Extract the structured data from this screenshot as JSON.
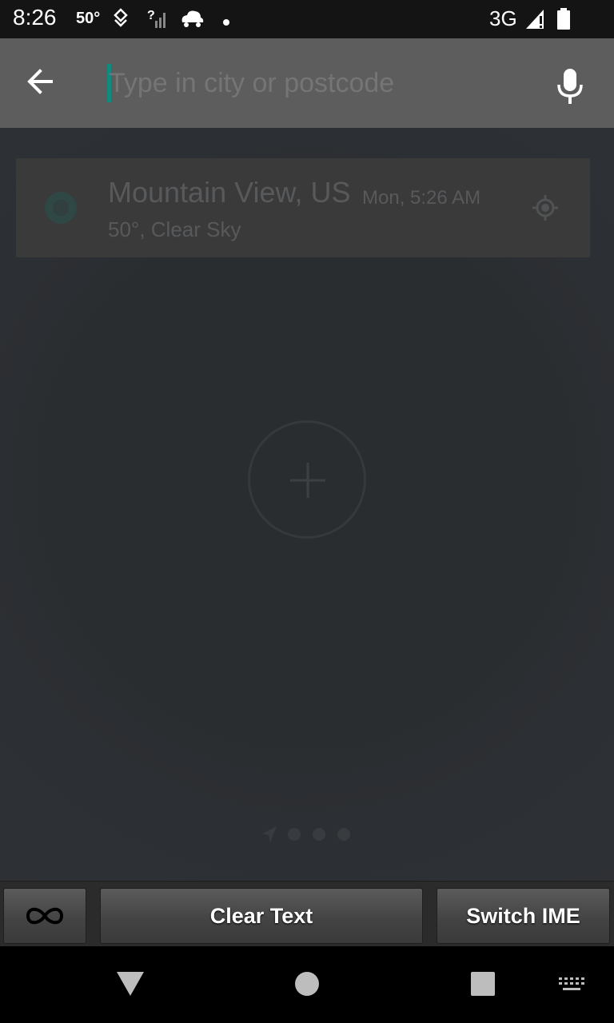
{
  "status_bar": {
    "time": "8:26",
    "temperature": "50°",
    "network": "3G",
    "icons": [
      "location-icon",
      "signal-unknown-icon",
      "cloud-car-icon",
      "notification-dot-icon",
      "cell-signal-icon",
      "battery-icon"
    ]
  },
  "app_bar": {
    "back_icon": "arrow-back-icon",
    "search": {
      "value": "",
      "placeholder": "Type in city or postcode"
    },
    "mic_icon": "microphone-icon",
    "accent_color": "#0f8a7c"
  },
  "city_card": {
    "name": "Mountain View, US",
    "time": "Mon, 5:26 AM",
    "weather": "50°, Clear Sky"
  },
  "pager": {
    "active": 0,
    "count": 4
  },
  "toolbar": {
    "infinity_icon": "infinity-icon",
    "clear_text_label": "Clear Text",
    "switch_ime_label": "Switch IME"
  },
  "nav_bar": {
    "icons": [
      "nav-back-icon",
      "nav-home-icon",
      "nav-recents-icon",
      "keyboard-icon"
    ]
  }
}
